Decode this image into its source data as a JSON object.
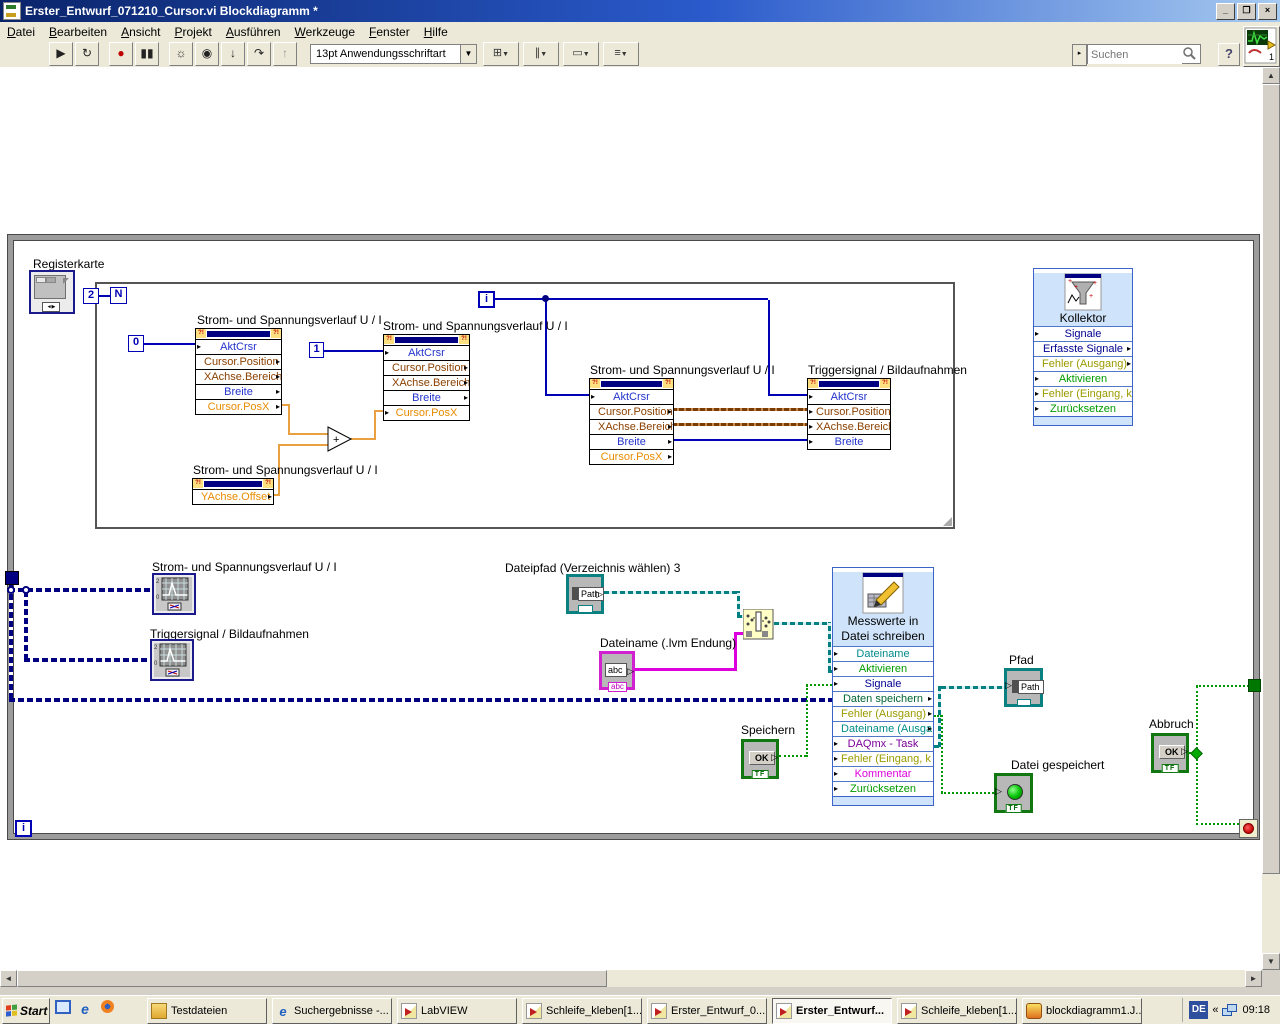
{
  "window": {
    "title": "Erster_Entwurf_071210_Cursor.vi Blockdiagramm *"
  },
  "menu": {
    "items": [
      "Datei",
      "Bearbeiten",
      "Ansicht",
      "Projekt",
      "Ausführen",
      "Werkzeuge",
      "Fenster",
      "Hilfe"
    ]
  },
  "toolbar": {
    "font_selector": "13pt Anwendungsschriftart",
    "search": {
      "placeholder": "Suchen"
    },
    "help_label": "?",
    "icons": {
      "run": "▶",
      "run_continuous": "↻",
      "abort": "●",
      "pause": "▮▮",
      "highlight_execution": "☼",
      "retain_wire_values": "◉",
      "step_into": "↓",
      "step_over": "↷",
      "step_out": "↑",
      "align": "⊞",
      "distribute": "∥",
      "resize": "▭",
      "reorder": "≡",
      "dropdown_arrow": "▼",
      "combo_arrow": "▸"
    }
  },
  "palette": {
    "integer_wire": "#0000B4",
    "double_wire": "#E8A040",
    "cluster_wire": "#7A3C00",
    "dynamic_wire": "#000080",
    "path_wire": "#008080",
    "string_wire": "#DD00DD",
    "boolean_wire": "#009900",
    "error_text": "#9B9B00",
    "boolean_text": "#009B00",
    "path_text": "#008B8B",
    "daqmx_text": "#7B0099",
    "string_text": "#DD00DD"
  },
  "diagram": {
    "labels": {
      "registerkarte": "Registerkarte"
    },
    "constants": {
      "loop_count": "2",
      "n": "N",
      "zero": "0",
      "one": "1",
      "for_iteration": "i",
      "while_iteration": "i"
    },
    "property_nodes": [
      {
        "title": "Strom- und Spannungsverlauf U / I",
        "rows": [
          {
            "label": "AktCrsr"
          },
          {
            "label": "Cursor.Position"
          },
          {
            "label": "XAchse.Bereich"
          },
          {
            "label": "Breite"
          },
          {
            "label": "Cursor.PosX"
          }
        ]
      },
      {
        "title": "Strom- und Spannungsverlauf U / I",
        "rows": [
          {
            "label": "AktCrsr"
          },
          {
            "label": "Cursor.Position"
          },
          {
            "label": "XAchse.Bereich"
          },
          {
            "label": "Breite"
          },
          {
            "label": "Cursor.PosX"
          }
        ]
      },
      {
        "title": "Strom- und Spannungsverlauf U / I",
        "rows": [
          {
            "label": "AktCrsr"
          },
          {
            "label": "Cursor.Position"
          },
          {
            "label": "XAchse.Bereich"
          },
          {
            "label": "Breite"
          },
          {
            "label": "Cursor.PosX"
          }
        ]
      },
      {
        "title": "Triggersignal / Bildaufnahmen",
        "rows": [
          {
            "label": "AktCrsr"
          },
          {
            "label": "Cursor.Position"
          },
          {
            "label": "XAchse.Bereich"
          },
          {
            "label": "Breite"
          }
        ]
      },
      {
        "title": "Strom- und Spannungsverlauf U / I",
        "rows": [
          {
            "label": "YAchse.Offset"
          }
        ]
      }
    ],
    "kollektor": {
      "title": "Kollektor",
      "rows": [
        {
          "label": "Signale"
        },
        {
          "label": "Erfasste Signale"
        },
        {
          "label": "Fehler (Ausgang)"
        },
        {
          "label": "Aktivieren"
        },
        {
          "label": "Fehler (Eingang, k"
        },
        {
          "label": "Zurücksetzen"
        }
      ]
    },
    "graph_terminals": [
      {
        "label": "Strom- und Spannungsverlauf U / I"
      },
      {
        "label": "Triggersignal / Bildaufnahmen"
      }
    ],
    "path_control": {
      "label": "Dateipfad (Verzeichnis wählen) 3",
      "icon_text": "Path"
    },
    "string_control": {
      "label": "Dateiname (.lvm Endung)",
      "icon_text": "abc",
      "tab_text": "abc"
    },
    "write_vi": {
      "title_lines": [
        "Messwerte in",
        "Datei schreiben"
      ],
      "rows": [
        {
          "label": "Dateiname"
        },
        {
          "label": "Aktivieren"
        },
        {
          "label": "Signale"
        },
        {
          "label": "Daten speichern"
        },
        {
          "label": "Fehler (Ausgang)"
        },
        {
          "label": "Dateiname (Ausga"
        },
        {
          "label": "DAQmx - Task"
        },
        {
          "label": "Fehler (Eingang, k"
        },
        {
          "label": "Kommentar"
        },
        {
          "label": "Zurücksetzen"
        }
      ]
    },
    "speichern": {
      "label": "Speichern",
      "button": "OK",
      "tf": "TF"
    },
    "abbruch": {
      "label": "Abbruch",
      "button": "OK",
      "tf": "TF"
    },
    "pfad": {
      "label": "Pfad",
      "icon_text": "Path"
    },
    "datei_gespeichert": {
      "label": "Datei gespeichert",
      "tf": "TF"
    }
  },
  "taskbar": {
    "start": "Start",
    "tasks": [
      {
        "label": "Testdateien"
      },
      {
        "label": "Suchergebnisse -..."
      },
      {
        "label": "LabVIEW"
      },
      {
        "label": "Schleife_kleben[1..."
      },
      {
        "label": "Erster_Entwurf_0..."
      },
      {
        "label": "Erster_Entwurf...",
        "active": true
      },
      {
        "label": "Schleife_kleben[1..."
      },
      {
        "label": "blockdiagramm1.J..."
      }
    ],
    "tray": {
      "language": "DE",
      "chevrons": "«",
      "clock": "09:18"
    }
  }
}
